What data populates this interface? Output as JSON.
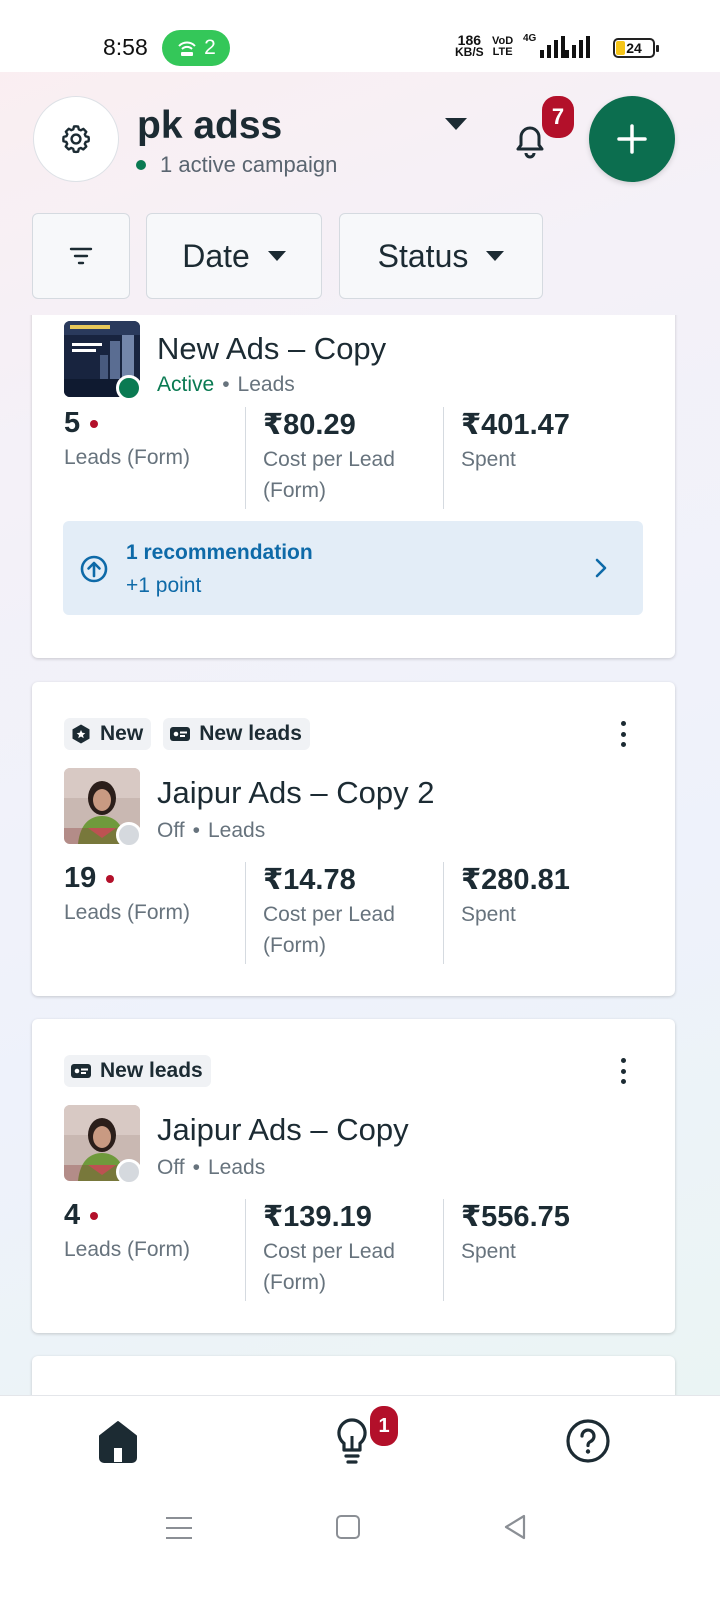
{
  "status_bar": {
    "time": "8:58",
    "hotspot_count": "2",
    "speed_value": "186",
    "speed_unit": "KB/S",
    "vol_top": "VoD",
    "vol_bottom": "LTE",
    "net_type": "4G",
    "battery": "24"
  },
  "header": {
    "account_name": "pk adss",
    "active_campaigns": "1 active campaign",
    "notification_count": "7",
    "icons": {
      "settings": "gear-icon",
      "notifications": "bell-icon",
      "add": "plus-icon"
    }
  },
  "filters": {
    "date_label": "Date",
    "status_label": "Status"
  },
  "campaigns": [
    {
      "name": "New Ads – Copy",
      "status": "Active",
      "objective": "Leads",
      "status_color": "#0a7a52",
      "results": "5",
      "results_label": "Leads (Form)",
      "cost": "₹80.29",
      "cost_label_1": "Cost per Lead",
      "cost_label_2": "(Form)",
      "spent": "₹401.47",
      "spent_label": "Spent",
      "recommendation": {
        "title": "1 recommendation",
        "points": "+1 point"
      }
    },
    {
      "tags": [
        "New",
        "New leads"
      ],
      "name": "Jaipur Ads – Copy 2",
      "status": "Off",
      "objective": "Leads",
      "status_color": "#d5d9de",
      "results": "19",
      "results_label": "Leads (Form)",
      "cost": "₹14.78",
      "cost_label_1": "Cost per Lead",
      "cost_label_2": "(Form)",
      "spent": "₹280.81",
      "spent_label": "Spent"
    },
    {
      "tags": [
        "New leads"
      ],
      "name": "Jaipur Ads – Copy",
      "status": "Off",
      "objective": "Leads",
      "status_color": "#d5d9de",
      "results": "4",
      "results_label": "Leads (Form)",
      "cost": "₹139.19",
      "cost_label_1": "Cost per Lead",
      "cost_label_2": "(Form)",
      "spent": "₹556.75",
      "spent_label": "Spent"
    }
  ],
  "separator": "•",
  "bottom_nav": {
    "ideas_badge": "1",
    "icons": [
      "home-icon",
      "lightbulb-icon",
      "help-icon"
    ]
  },
  "colors": {
    "brand_green": "#0c6e4f",
    "badge_red": "#b3102a",
    "link_blue": "#0e6aa8"
  }
}
